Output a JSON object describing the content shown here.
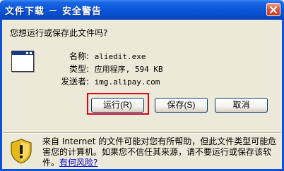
{
  "dialog": {
    "title": "文件下载 － 安全警告",
    "question": "您想运行或保存此文件吗?"
  },
  "file": {
    "name_label": "名称:",
    "name_value": "aliedit.exe",
    "type_label": "类型:",
    "type_value": "应用程序, 594 KB",
    "from_label": "发送者:",
    "from_value": "img.alipay.com"
  },
  "buttons": {
    "run": "运行(R)",
    "save": "保存(S)",
    "cancel": "取消"
  },
  "warning": {
    "text": "来自 Internet 的文件可能对您有所帮助，但此文件类型可能危害您的计算机。如果您不信任其来源，请不要运行或保存该软件。",
    "link": "有何风险?"
  },
  "colors": {
    "highlight": "#e0001a",
    "title_bar": "#0a56d8"
  }
}
